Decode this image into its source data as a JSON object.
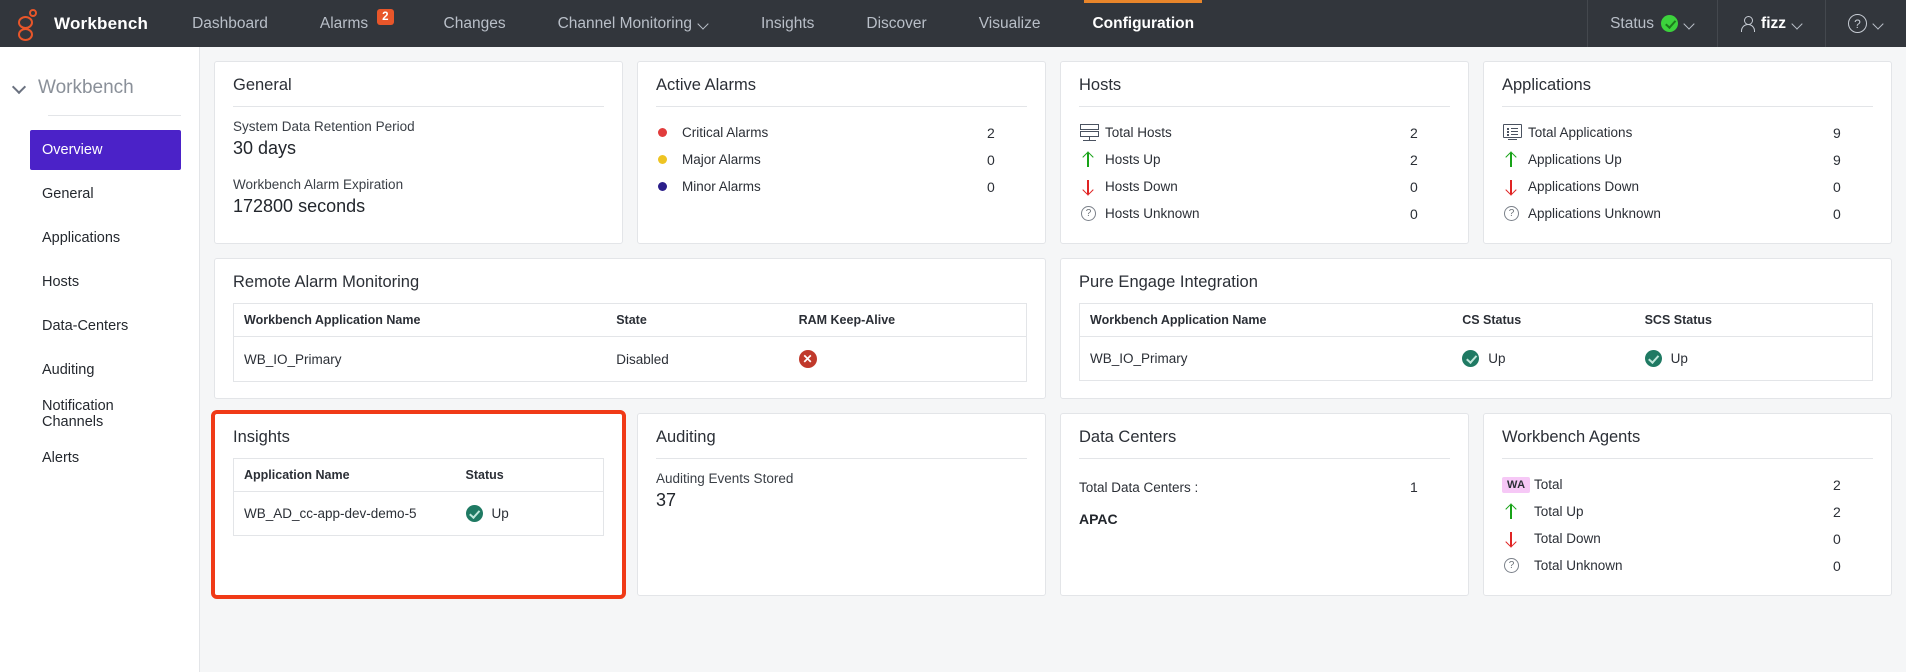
{
  "topnav": {
    "brand": "Workbench",
    "items": [
      {
        "label": "Dashboard",
        "badge": "",
        "caret": false,
        "active": false
      },
      {
        "label": "Alarms",
        "badge": "2",
        "caret": false,
        "active": false
      },
      {
        "label": "Changes",
        "badge": "",
        "caret": false,
        "active": false
      },
      {
        "label": "Channel Monitoring",
        "badge": "",
        "caret": true,
        "active": false
      },
      {
        "label": "Insights",
        "badge": "",
        "caret": false,
        "active": false
      },
      {
        "label": "Discover",
        "badge": "",
        "caret": false,
        "active": false
      },
      {
        "label": "Visualize",
        "badge": "",
        "caret": false,
        "active": false
      },
      {
        "label": "Configuration",
        "badge": "",
        "caret": false,
        "active": true
      }
    ],
    "status_label": "Status",
    "user_label": "fizz",
    "help_label": "?"
  },
  "sidebar": {
    "title": "Workbench",
    "items": [
      {
        "label": "Overview",
        "active": true
      },
      {
        "label": "General",
        "active": false
      },
      {
        "label": "Applications",
        "active": false
      },
      {
        "label": "Hosts",
        "active": false
      },
      {
        "label": "Data-Centers",
        "active": false
      },
      {
        "label": "Auditing",
        "active": false
      },
      {
        "label": "Notification Channels",
        "active": false
      },
      {
        "label": "Alerts",
        "active": false
      }
    ]
  },
  "general": {
    "title": "General",
    "retention_label": "System Data Retention Period",
    "retention_value": "30 days",
    "expiration_label": "Workbench Alarm Expiration",
    "expiration_value": "172800 seconds"
  },
  "active_alarms": {
    "title": "Active Alarms",
    "rows": [
      {
        "icon": "critical-dot-icon",
        "label": "Critical Alarms",
        "value": "2"
      },
      {
        "icon": "major-dot-icon",
        "label": "Major Alarms",
        "value": "0"
      },
      {
        "icon": "minor-dot-icon",
        "label": "Minor Alarms",
        "value": "0"
      }
    ]
  },
  "hosts": {
    "title": "Hosts",
    "rows": [
      {
        "icon": "server-icon",
        "label": "Total Hosts",
        "value": "2"
      },
      {
        "icon": "arrow-up-icon",
        "label": "Hosts Up",
        "value": "2"
      },
      {
        "icon": "arrow-down-icon",
        "label": "Hosts Down",
        "value": "0"
      },
      {
        "icon": "question-icon",
        "label": "Hosts Unknown",
        "value": "0"
      }
    ]
  },
  "applications": {
    "title": "Applications",
    "rows": [
      {
        "icon": "application-icon",
        "label": "Total Applications",
        "value": "9"
      },
      {
        "icon": "arrow-up-icon",
        "label": "Applications Up",
        "value": "9"
      },
      {
        "icon": "arrow-down-icon",
        "label": "Applications Down",
        "value": "0"
      },
      {
        "icon": "question-icon",
        "label": "Applications Unknown",
        "value": "0"
      }
    ]
  },
  "remote_alarm_monitoring": {
    "title": "Remote Alarm Monitoring",
    "columns": [
      "Workbench Application Name",
      "State",
      "RAM Keep-Alive"
    ],
    "rows": [
      {
        "name": "WB_IO_Primary",
        "state": "Disabled",
        "keepalive_icon": "error-x-icon"
      }
    ]
  },
  "pure_engage": {
    "title": "Pure Engage Integration",
    "columns": [
      "Workbench Application Name",
      "CS Status",
      "SCS Status"
    ],
    "rows": [
      {
        "name": "WB_IO_Primary",
        "cs_status": "Up",
        "scs_status": "Up"
      }
    ]
  },
  "insights": {
    "title": "Insights",
    "columns": [
      "Application Name",
      "Status"
    ],
    "rows": [
      {
        "name": "WB_AD_cc-app-dev-demo-5",
        "status": "Up"
      }
    ]
  },
  "auditing": {
    "title": "Auditing",
    "events_label": "Auditing Events Stored",
    "events_value": "37"
  },
  "data_centers": {
    "title": "Data Centers",
    "total_label": "Total Data Centers :",
    "total_value": "1",
    "name": "APAC"
  },
  "workbench_agents": {
    "title": "Workbench Agents",
    "rows": [
      {
        "icon": "wa-badge-icon",
        "label": "Total",
        "value": "2"
      },
      {
        "icon": "arrow-up-icon",
        "label": "Total Up",
        "value": "2"
      },
      {
        "icon": "arrow-down-icon",
        "label": "Total Down",
        "value": "0"
      },
      {
        "icon": "question-icon",
        "label": "Total Unknown",
        "value": "0"
      }
    ]
  },
  "colors": {
    "nav_bg": "#32363c",
    "accent_orange": "#e8852a",
    "brand_orange": "#e8562a",
    "sidebar_active": "#4b22c8",
    "critical": "#e13c3c",
    "major": "#eec423",
    "minor": "#2b1f8a",
    "up_green": "#18a318",
    "down_red": "#e02424",
    "ok_teal": "#1f7a63",
    "error_red": "#c0392b",
    "highlight": "#f03a17",
    "wa_badge_bg": "#f6c8f6"
  }
}
